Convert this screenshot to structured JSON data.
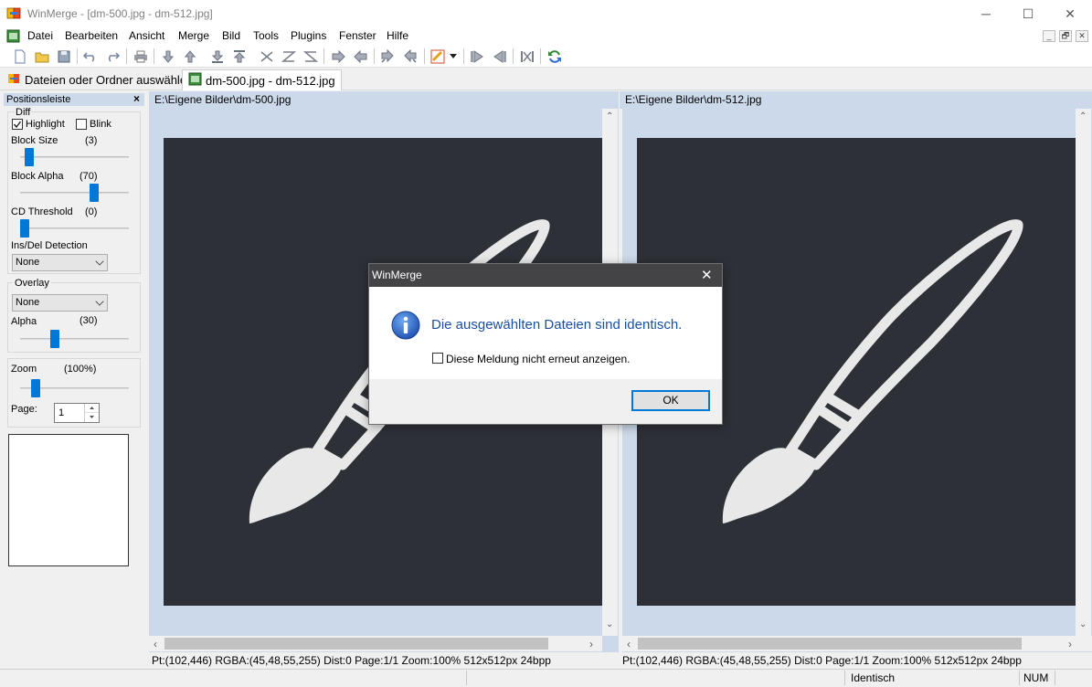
{
  "window": {
    "title": "WinMerge - [dm-500.jpg - dm-512.jpg]",
    "minimize_glyph": "─",
    "maximize_glyph": "☐",
    "close_glyph": "✕"
  },
  "menu": {
    "items": [
      "Datei",
      "Bearbeiten",
      "Ansicht",
      "Merge",
      "Bild",
      "Tools",
      "Plugins",
      "Fenster",
      "Hilfe"
    ]
  },
  "mdi_buttons": [
    "_",
    "🗗",
    "✕"
  ],
  "toolbar": {
    "icons": [
      "new-icon",
      "open-icon",
      "save-icon",
      "undo-icon",
      "redo-icon",
      "print-icon",
      "next-diff-icon",
      "prev-diff-icon",
      "first-diff-icon",
      "last-diff-icon",
      "current-diff-icon",
      "all-left-icon",
      "all-right-icon",
      "copy-right-icon",
      "copy-left-icon",
      "copy-right-advance-icon",
      "copy-left-advance-icon",
      "options-icon",
      "dropdown-icon",
      "next-file-icon",
      "prev-file-icon",
      "compare-icon",
      "refresh-icon"
    ]
  },
  "tabs": [
    {
      "label": "Dateien oder Ordner auswählen",
      "icon": "open-folder-icon"
    },
    {
      "label": "dm-500.jpg - dm-512.jpg",
      "icon": "image-compare-icon"
    }
  ],
  "location_pane": {
    "title": "Positionsleiste",
    "close_glyph": "×",
    "diff_group": "Diff",
    "highlight_label": "Highlight",
    "highlight_checked": true,
    "blink_label": "Blink",
    "blink_checked": false,
    "block_size_label": "Block Size",
    "block_size_value": "(3)",
    "block_size_level": 0.05,
    "block_alpha_label": "Block Alpha",
    "block_alpha_value": "(70)",
    "block_alpha_level": 0.7,
    "cd_threshold_label": "CD Threshold",
    "cd_threshold_value": "(0)",
    "cd_threshold_level": 0.0,
    "insdel_label": "Ins/Del Detection",
    "insdel_value": "None",
    "overlay_group": "Overlay",
    "overlay_value": "None",
    "alpha_label": "Alpha",
    "alpha_value": "(30)",
    "alpha_level": 0.3,
    "zoom_label": "Zoom",
    "zoom_value": "(100%)",
    "page_label": "Page:",
    "page_value": "1"
  },
  "left_pane": {
    "path": "E:\\Eigene Bilder\\dm-500.jpg",
    "status": "Pt:(102,446) RGBA:(45,48,55,255) Dist:0 Page:1/1 Zoom:100% 512x512px 24bpp"
  },
  "right_pane": {
    "path": "E:\\Eigene Bilder\\dm-512.jpg",
    "status": "Pt:(102,446) RGBA:(45,48,55,255) Dist:0 Page:1/1 Zoom:100% 512x512px 24bpp"
  },
  "statusbar": {
    "state": "Identisch",
    "num": "NUM"
  },
  "dialog": {
    "title": "WinMerge",
    "close_glyph": "✕",
    "message": "Die ausgewählten Dateien sind identisch.",
    "checkbox_label": "Diese Meldung nicht erneut anzeigen.",
    "checkbox_checked": false,
    "ok_label": "OK"
  },
  "colors": {
    "image_bg": "#2d3037",
    "pane_bg": "#cbd9ea",
    "accent": "#0078d7",
    "dialog_title_bg": "#444447",
    "dialog_message": "#1a4fa0"
  }
}
